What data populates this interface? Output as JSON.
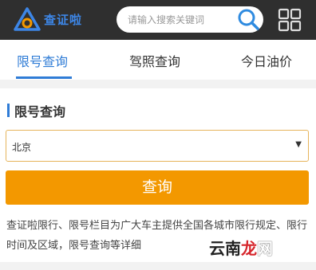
{
  "header": {
    "logo_text": "查证啦",
    "search_placeholder": "请输入搜索关键词"
  },
  "tabs": [
    {
      "label": "限号查询",
      "active": true
    },
    {
      "label": "驾照查询",
      "active": false
    },
    {
      "label": "今日油价",
      "active": false
    }
  ],
  "section": {
    "title": "限号查询"
  },
  "city_select": {
    "value": "北京"
  },
  "query_button": {
    "label": "查询"
  },
  "description": "查证啦限行、限号栏目为广大车主提供全国各城市限行规定、限行时间及区域，限号查询等详细",
  "watermark": {
    "part1": "云南",
    "part2": "龙",
    "part3": "网"
  },
  "colors": {
    "topbar": "#2f2f2f",
    "brand_blue": "#2f7cd6",
    "button_orange": "#f39800"
  }
}
